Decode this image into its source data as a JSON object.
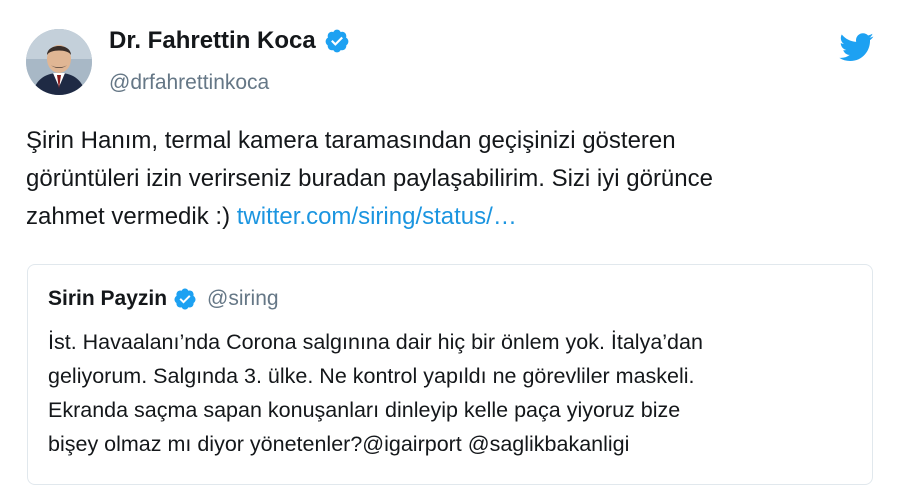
{
  "tweet": {
    "author_name": "Dr. Fahrettin Koca",
    "author_handle": "@drfahrettinkoca",
    "text_lines": [
      "Şirin Hanım, termal kamera taramasından geçişinizi gösteren",
      "görüntüleri izin verirseniz buradan paylaşabilirim. Sizi iyi görünce",
      "zahmet vermedik :) "
    ],
    "link_text": "twitter.com/siring/status/…",
    "icons": {
      "verified": "verified-badge-icon",
      "brand": "twitter-bird-icon"
    }
  },
  "quoted_tweet": {
    "author_name": "Sirin Payzin",
    "author_handle": "@siring",
    "text_lines": [
      "İst. Havaalanı’nda Corona salgınına dair hiç bir önlem yok. İtalya’dan",
      "geliyorum. Salgında 3. ülke. Ne kontrol yapıldı ne görevliler maskeli.",
      "Ekranda saçma sapan konuşanları dinleyip kelle paça yiyoruz bize",
      "bişey olmaz mı diyor yönetenler?@igairport @saglikbakanligi"
    ]
  },
  "colors": {
    "accent": "#1da1f2",
    "link": "#1b95e0",
    "muted_text": "#657786",
    "border": "#e1e8ed"
  }
}
